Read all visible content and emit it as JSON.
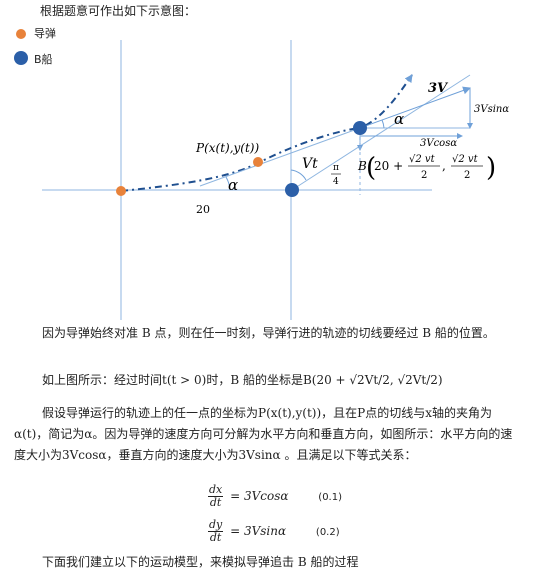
{
  "intro": "根据题意可作出如下示意图：",
  "legend": {
    "missile_label": "导弹",
    "ship_label": "B船",
    "missile_color": "#e8823a",
    "ship_color": "#2b5fa8"
  },
  "figure": {
    "label_3V": "3V",
    "label_3Vsin": "3Vsinα",
    "label_3Vcos": "3Vcosα",
    "label_alpha": "α",
    "label_Vt": "Vt",
    "label_pi": "π",
    "label_4": "4",
    "label_P": "P(x(t),y(t))",
    "label_B": "B",
    "label_B_coord": "(20 + √2vt/2, √2vt/2)",
    "label_B_open": "20 +",
    "label_B_num1": "√2 vt",
    "label_B_num2": "√2 vt",
    "label_B_den": "2",
    "label_20": "20"
  },
  "para1": "因为导弹始终对准 B 点，则在任一时刻，导弹行进的轨迹的切线要经过 B 船的位置。",
  "para2": "如上图所示：经过时间t(t > 0)时，B 船的坐标是B(20 + √2Vt/2, √2Vt/2)",
  "para3": "假设导弹运行的轨迹上的任一点的坐标为P(x(t),y(t))，且在P点的切线与x轴的夹角为α(t)，简记为α。因为导弹的速度方向可分解为水平方向和垂直方向，如图所示：水平方向的速度大小为3Vcosα，垂直方向的速度大小为3Vsinα 。且满足以下等式关系：",
  "eq1": {
    "num": "dx",
    "den": "dt",
    "rhs": "= 3Vcosα",
    "tag": "(0.1)"
  },
  "eq2": {
    "num": "dy",
    "den": "dt",
    "rhs": "= 3Vsinα",
    "tag": "(0.2)"
  },
  "cut_line": "下面我们建立以下的运动模型，来模拟导弹追击 B 船的过程"
}
